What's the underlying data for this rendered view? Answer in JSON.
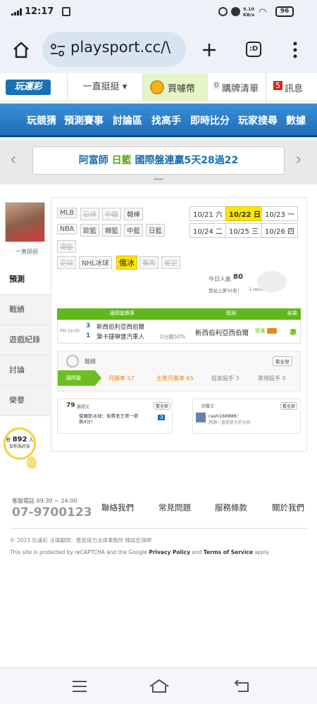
{
  "status": {
    "time": "12:17",
    "speed": "9.10\nKB/s",
    "battery": "96"
  },
  "browser": {
    "url": "playsport.cc/\\",
    "tabs_icon": ":D"
  },
  "header": {
    "logo": "玩運彩",
    "menu": "一直挺挺 ▾",
    "coins": "買噱幣",
    "cart_count": "0",
    "cart": "購牌清單",
    "msg_count": "5",
    "msg": "訊息"
  },
  "nav": [
    "玩競猜",
    "預測賽事",
    "討論區",
    "找高手",
    "即時比分",
    "玩家搜尋",
    "數據"
  ],
  "banner": {
    "name": "阿富師",
    "league": "日籃",
    "text": "國際盤連贏5天28過22"
  },
  "profile": {
    "name": "一直挺挺"
  },
  "tags": {
    "row1": [
      "MLB",
      "日棒",
      "中職",
      "韓棒"
    ],
    "row2": [
      "NBA",
      "歐籃",
      "韓籃",
      "中籃",
      "日籃"
    ],
    "row3": [
      "澳籃"
    ],
    "row4": [
      "足球",
      "NHL冰球",
      "俄冰",
      "賽馬",
      "美足"
    ]
  },
  "dates": [
    "10/21 六",
    "10/22 日",
    "10/23 一",
    "10/24 二",
    "10/25 三",
    "10/26 四"
  ],
  "today": {
    "label": "今日人氣",
    "value": "80",
    "rank": "是站上第35名！",
    "rank2": "1 record"
  },
  "match": {
    "head1": "國際盤賽事",
    "head2": "預測",
    "head3": "結果",
    "time": "PM 19:00",
    "n1": "3",
    "team1": "新西伯利亞西伯爾",
    "n2": "1",
    "team2": "葉卡捷琳堡汽車人",
    "odds": "0分輸50%",
    "pick": "新西伯利亞西伯爾",
    "pick_tag": "受讓",
    "result": "準"
  },
  "record": {
    "label": "戰績",
    "more": "看全部",
    "tab": "國際盤",
    "s1": "月勝率 57",
    "s2": "主推月勝率 65",
    "s3": "莊家殺手 3",
    "s4": "單場殺手 0"
  },
  "posts": {
    "count": "79",
    "label": "篇發文",
    "more": "看全部",
    "item": "俄羅斯冰球：免費老王第一節佩4分！",
    "reply": "3"
  },
  "replies": {
    "label": "回覆文",
    "more": "看全部",
    "user": "cash168888：",
    "text": "感謝一直挺挺大的分析"
  },
  "side": [
    "預測",
    "戰績",
    "遊戲紀錄",
    "討論",
    "榮譽"
  ],
  "online": {
    "pre": "有",
    "count": "892",
    "post": "人",
    "sub": "加你為好友"
  },
  "footer": {
    "tel_label": "客服電話 09:30 ~ 24:00",
    "tel": "07-9700123",
    "links": [
      "聯絡我們",
      "常見問題",
      "服務條款",
      "關於我們"
    ],
    "copy": "© 2023 玩運彩 法律顧問：蓋英得力法律事務所 陳銘宏律師",
    "cap1": "This site is protected by reCAPTCHA and the Google ",
    "pp": "Privacy Policy",
    "and": " and ",
    "tos": "Terms of Service",
    "apply": " apply."
  },
  "colors": {
    "blue": "#1e6db8",
    "green": "#6cbf1e",
    "orange": "#e58a1a",
    "red": "#d9281e"
  }
}
